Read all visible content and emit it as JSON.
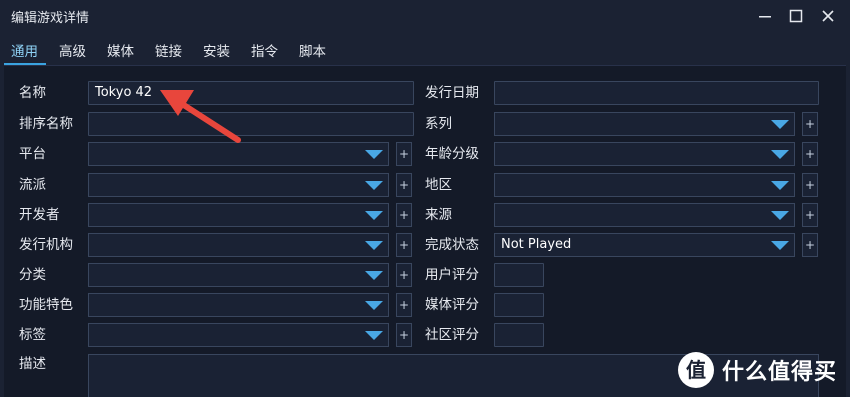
{
  "window": {
    "title": "编辑游戏详情"
  },
  "tabs": [
    {
      "label": "通用",
      "active": true
    },
    {
      "label": "高级"
    },
    {
      "label": "媒体"
    },
    {
      "label": "链接"
    },
    {
      "label": "安装"
    },
    {
      "label": "指令"
    },
    {
      "label": "脚本"
    }
  ],
  "left_fields": [
    {
      "label": "名称",
      "value": "Tokyo 42"
    },
    {
      "label": "排序名称",
      "value": ""
    },
    {
      "label": "平台",
      "value": ""
    },
    {
      "label": "流派",
      "value": ""
    },
    {
      "label": "开发者",
      "value": ""
    },
    {
      "label": "发行机构",
      "value": ""
    },
    {
      "label": "分类",
      "value": ""
    },
    {
      "label": "功能特色",
      "value": ""
    },
    {
      "label": "标签",
      "value": ""
    },
    {
      "label": "描述",
      "value": ""
    }
  ],
  "right_fields": [
    {
      "label": "发行日期",
      "value": ""
    },
    {
      "label": "系列",
      "value": ""
    },
    {
      "label": "年龄分级",
      "value": ""
    },
    {
      "label": "地区",
      "value": ""
    },
    {
      "label": "来源",
      "value": ""
    },
    {
      "label": "完成状态",
      "value": "Not Played"
    },
    {
      "label": "用户评分",
      "value": ""
    },
    {
      "label": "媒体评分",
      "value": ""
    },
    {
      "label": "社区评分",
      "value": ""
    }
  ],
  "plus_label": "+",
  "watermark": {
    "badge": "值",
    "text": "什么值得买"
  },
  "colors": {
    "accent": "#49a8e5",
    "annotation": "#e8463c",
    "background": "#141a28"
  }
}
